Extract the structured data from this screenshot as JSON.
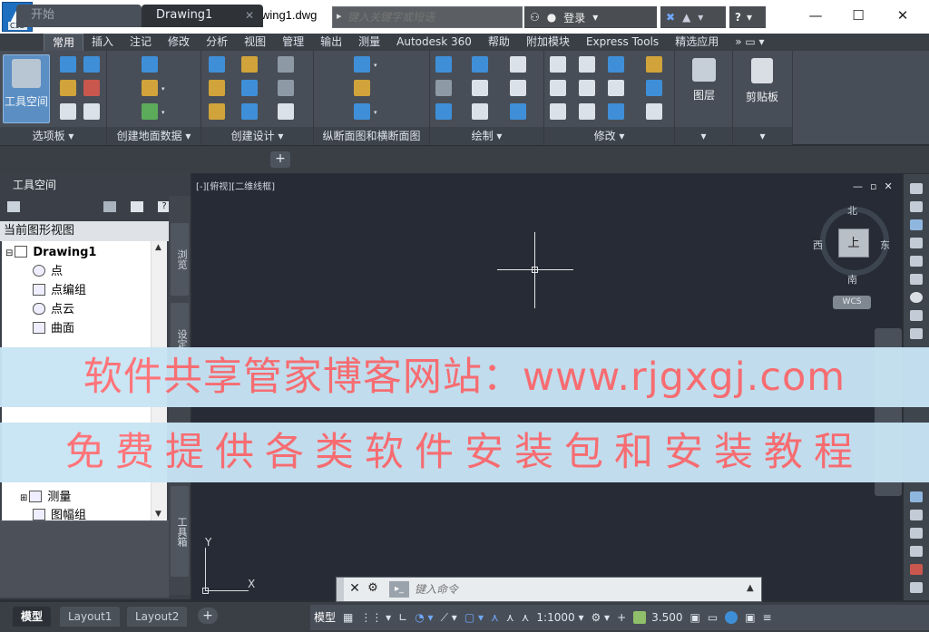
{
  "app": {
    "badge": "C3D",
    "title": "Drawing1.dwg"
  },
  "qat": {
    "items": [
      {
        "name": "new-icon",
        "glyph": "▭"
      },
      {
        "name": "open-icon",
        "glyph": "▭"
      },
      {
        "name": "save-icon",
        "glyph": "▪"
      },
      {
        "name": "print-icon",
        "glyph": "▭"
      },
      {
        "name": "undo-icon",
        "glyph": "↶"
      },
      {
        "name": "more-icon",
        "glyph": "»"
      }
    ]
  },
  "search": {
    "placeholder": "键入关键字或短语"
  },
  "account": {
    "signin": "登录",
    "help": "?"
  },
  "window": {
    "minimize": "—",
    "maximize": "☐",
    "close": "✕"
  },
  "ribbon_tabs": [
    "常用",
    "插入",
    "注记",
    "修改",
    "分析",
    "视图",
    "管理",
    "输出",
    "测量",
    "Autodesk 360",
    "帮助",
    "附加模块",
    "Express Tools",
    "精选应用"
  ],
  "ribbon_tabs_active": 0,
  "panels": [
    {
      "title": "选项板"
    },
    {
      "title": "创建地面数据"
    },
    {
      "title": "创建设计"
    },
    {
      "title": "纵断面图和横断面图"
    },
    {
      "title": "绘制"
    },
    {
      "title": "修改"
    },
    {
      "title": ""
    },
    {
      "title": ""
    }
  ],
  "big_tools": {
    "toolspace": "工具空间",
    "layer": "图层",
    "clipboard": "剪贴板"
  },
  "doc_tabs": {
    "start": "开始",
    "drawing": "Drawing1",
    "close": "✕",
    "new": "+"
  },
  "toolspace": {
    "header": "工具空间",
    "current_view": "当前图形视图",
    "tree": [
      {
        "label": "Drawing1",
        "level": 0,
        "bold": true
      },
      {
        "label": "点",
        "level": 1
      },
      {
        "label": "点编组",
        "level": 1
      },
      {
        "label": "点云",
        "level": 1
      },
      {
        "label": "曲面",
        "level": 1
      },
      {
        "label": "测量",
        "level": 1
      },
      {
        "label": "图幅组",
        "level": 1
      }
    ],
    "side_tabs": [
      "浏览",
      "设定",
      "工具箱"
    ]
  },
  "viewport": {
    "label": "[-][俯视][二维线框]",
    "controls": [
      "—",
      "▫",
      "✕"
    ],
    "compass": {
      "north": "北",
      "south": "南",
      "east": "东",
      "west": "西",
      "top": "上"
    },
    "wcs": "WCS",
    "ucs": {
      "x": "X",
      "y": "Y"
    }
  },
  "command": {
    "placeholder": "键入命令",
    "close": "✕",
    "customize": "🔧"
  },
  "layout_tabs": [
    "模型",
    "Layout1",
    "Layout2"
  ],
  "layout_active": 0,
  "status": {
    "model": "模型",
    "scale": "1:1000",
    "elevation": "3.500"
  },
  "watermark": {
    "line1": "软件共享管家博客网站：www.rjgxgj.com",
    "line2": "免费提供各类软件安装包和安装教程"
  },
  "colors": {
    "accent": "#1f6fc0",
    "watermark_text": "#ff6f74",
    "watermark_bg": "#c8e4f4"
  }
}
